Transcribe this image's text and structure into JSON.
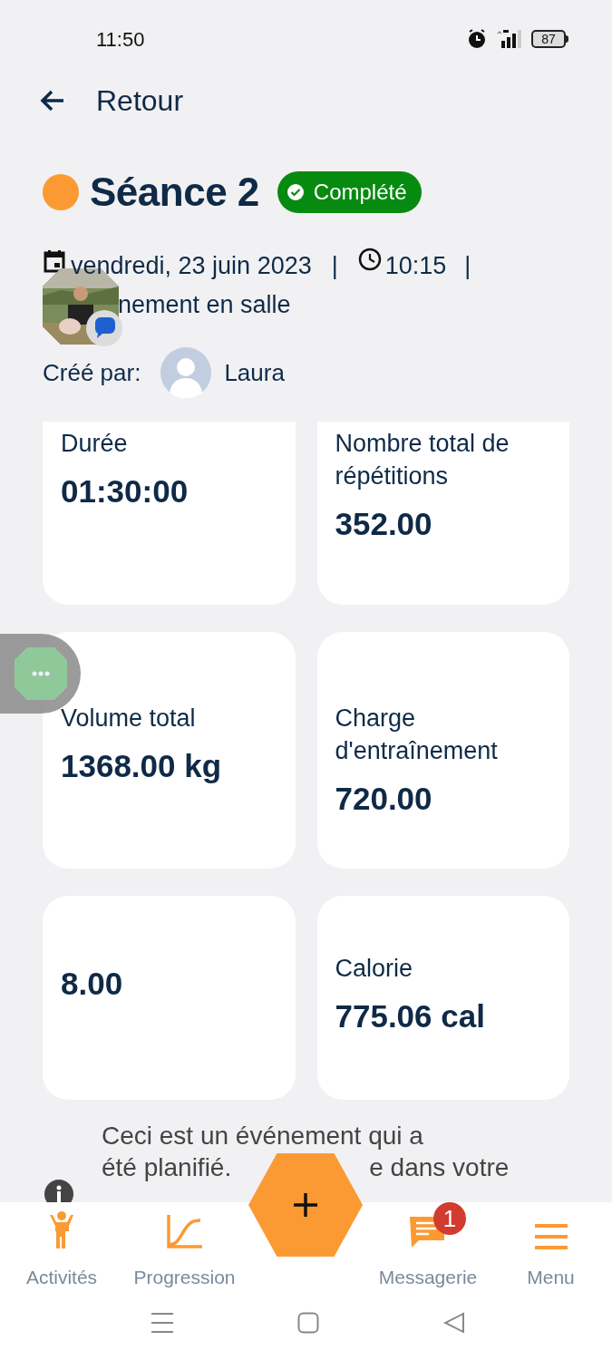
{
  "status_bar": {
    "time": "11:50",
    "battery": "87"
  },
  "back_link": {
    "label": "Retour"
  },
  "session": {
    "title": "Séance 2",
    "color": "#fb9a33",
    "status": "Complété",
    "completed": true,
    "date": "vendredi, 23 juin 2023",
    "separator_1": "|",
    "time": "10:15",
    "separator_2": "|",
    "location": "nement en salle",
    "created_by_label": "Créé par:",
    "creator": "Laura"
  },
  "stats": [
    {
      "label": "Durée",
      "value": "01:30:00"
    },
    {
      "label": "Nombre total de répétitions",
      "value": "352.00"
    },
    {
      "label": "Volume total",
      "value": "1368.00 kg"
    },
    {
      "label": "Charge d'entraînement",
      "value": "720.00"
    },
    {
      "value": "8.00"
    },
    {
      "label": "Calorie",
      "value": "775.06 cal"
    }
  ],
  "note": {
    "line_1": "Ceci est un événement qui a",
    "line_2_start": "été planifié.",
    "line_2_end": "e dans votre"
  },
  "bottom_nav": [
    {
      "label": "Activités"
    },
    {
      "label": "Progression"
    },
    {
      "label": "Messagerie",
      "badge": "1"
    },
    {
      "label": "Menu"
    }
  ]
}
